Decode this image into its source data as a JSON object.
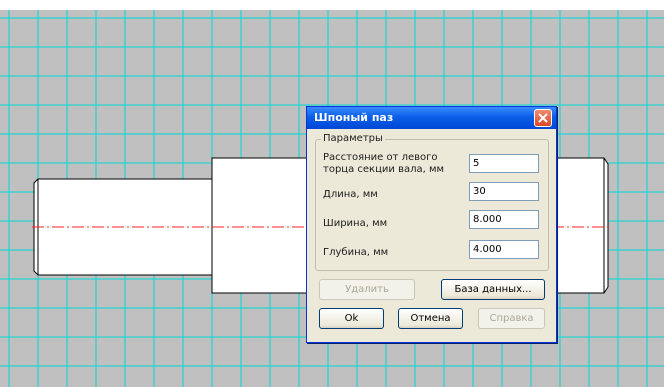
{
  "dialog": {
    "title": "Шпоный паз",
    "group_label": "Параметры",
    "fields": [
      {
        "label_line1": "Расстояние от левого",
        "label_line2": "торца секции вала, мм",
        "value": "5"
      },
      {
        "label_line1": "Длина, мм",
        "label_line2": "",
        "value": "30"
      },
      {
        "label_line1": "Ширина, мм",
        "label_line2": "",
        "value": "8.000"
      },
      {
        "label_line1": "Глубина, мм",
        "label_line2": "",
        "value": "4.000"
      }
    ],
    "buttons": {
      "delete": "Удалить",
      "database": "База данных...",
      "ok": "Ok",
      "cancel": "Отмена",
      "help": "Справка"
    }
  },
  "colors": {
    "grid": "#00d8d8",
    "drawing_bg": "#c0c0c0",
    "centerline": "#ff2020",
    "title_bar": "#0a5fe7"
  }
}
